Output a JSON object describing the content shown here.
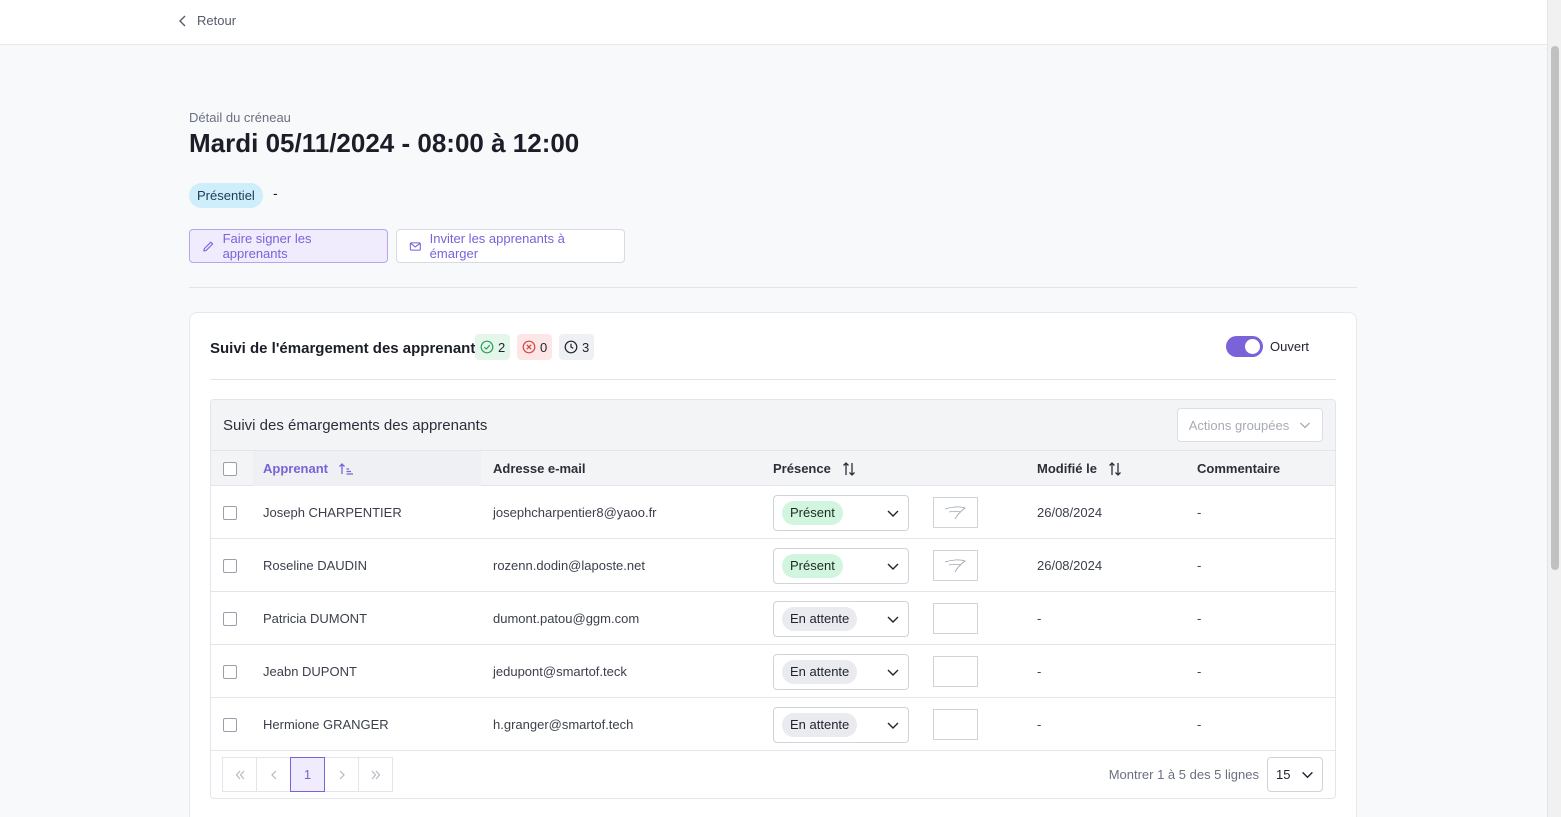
{
  "nav": {
    "back_label": "Retour"
  },
  "header": {
    "subtitle": "Détail du créneau",
    "title": "Mardi 05/11/2024 - 08:00 à 12:00",
    "mode_badge": "Présentiel",
    "mode_extra": "-"
  },
  "actions": {
    "sign_label": "Faire signer les apprenants",
    "invite_label": "Inviter les apprenants à émarger"
  },
  "tracking": {
    "title": "Suivi de l'émargement des apprenants",
    "count_signed": "2",
    "count_absent": "0",
    "count_pending": "3",
    "toggle_label": "Ouvert",
    "toggle_on": true
  },
  "table": {
    "title": "Suivi des émargements des apprenants",
    "bulk_actions_label": "Actions groupées",
    "columns": {
      "learner": "Apprenant",
      "email": "Adresse e-mail",
      "presence": "Présence",
      "modified": "Modifié le",
      "comment": "Commentaire"
    },
    "rows": [
      {
        "name": "Joseph CHARPENTIER",
        "email": "josephcharpentier8@yaoo.fr",
        "presence": "Présent",
        "status": "present",
        "signed": true,
        "modified": "26/08/2024",
        "comment": "-"
      },
      {
        "name": "Roseline DAUDIN",
        "email": "rozenn.dodin@laposte.net",
        "presence": "Présent",
        "status": "present",
        "signed": true,
        "modified": "26/08/2024",
        "comment": "-"
      },
      {
        "name": "Patricia DUMONT",
        "email": "dumont.patou@ggm.com",
        "presence": "En attente",
        "status": "waiting",
        "signed": false,
        "modified": "-",
        "comment": "-"
      },
      {
        "name": "Jeabn DUPONT",
        "email": "jedupont@smartof.teck",
        "presence": "En attente",
        "status": "waiting",
        "signed": false,
        "modified": "-",
        "comment": "-"
      },
      {
        "name": "Hermione GRANGER",
        "email": "h.granger@smartof.tech",
        "presence": "En attente",
        "status": "waiting",
        "signed": false,
        "modified": "-",
        "comment": "-"
      }
    ]
  },
  "pagination": {
    "current_page": "1",
    "rows_info": "Montrer 1 à 5 des 5 lignes",
    "page_size": "15"
  }
}
